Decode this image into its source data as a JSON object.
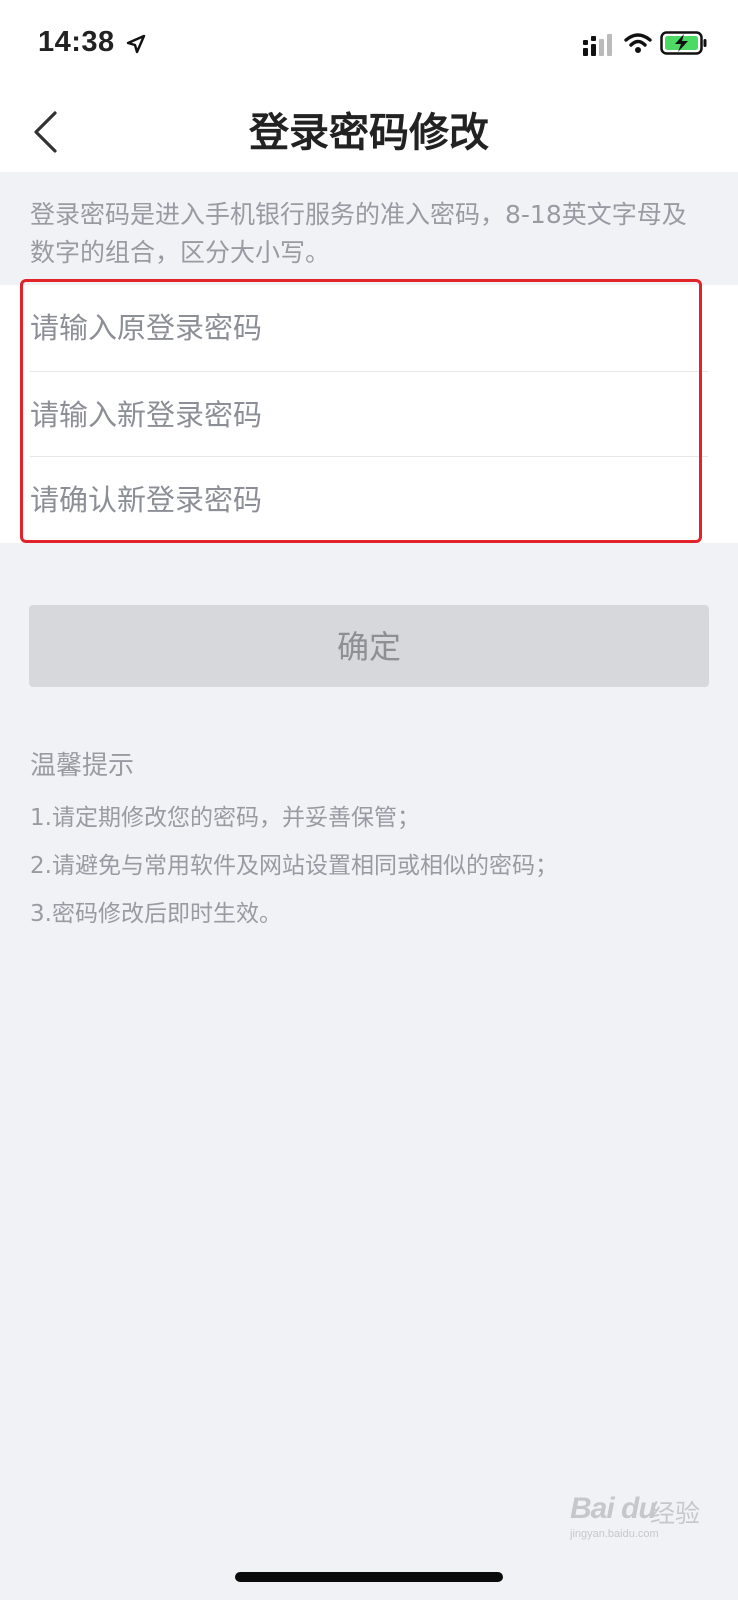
{
  "status_bar": {
    "time": "14:38",
    "icons": [
      "location-arrow-icon",
      "cellular-signal-icon",
      "wifi-icon",
      "battery-charging-icon"
    ]
  },
  "nav": {
    "title": "登录密码修改",
    "back_icon": "chevron-left-icon"
  },
  "description": "登录密码是进入手机银行服务的准入密码，8-18英文字母及数字的组合，区分大小写。",
  "form": {
    "old_password_placeholder": "请输入原登录密码",
    "new_password_placeholder": "请输入新登录密码",
    "confirm_password_placeholder": "请确认新登录密码"
  },
  "confirm_button": {
    "label": "确定",
    "enabled": false
  },
  "tips": {
    "title": "温馨提示",
    "items": [
      "1.请定期修改您的密码，并妥善保管；",
      "2.请避免与常用软件及网站设置相同或相似的密码；",
      "3.密码修改后即时生效。"
    ]
  },
  "watermark": {
    "brand": "Bai du",
    "cn": "经验",
    "domain": "jingyan.baidu.com"
  },
  "colors": {
    "background": "#f1f2f6",
    "highlight_border": "#e2232a",
    "disabled_button": "#d7d8dc",
    "hint_text": "#999ba3",
    "battery": "#4cd964"
  }
}
